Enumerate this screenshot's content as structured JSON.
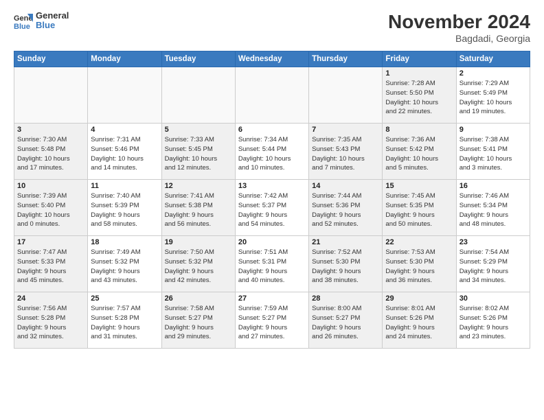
{
  "header": {
    "logo_line1": "General",
    "logo_line2": "Blue",
    "month": "November 2024",
    "location": "Bagdadi, Georgia"
  },
  "weekdays": [
    "Sunday",
    "Monday",
    "Tuesday",
    "Wednesday",
    "Thursday",
    "Friday",
    "Saturday"
  ],
  "weeks": [
    [
      {
        "day": "",
        "info": "",
        "empty": true
      },
      {
        "day": "",
        "info": "",
        "empty": true
      },
      {
        "day": "",
        "info": "",
        "empty": true
      },
      {
        "day": "",
        "info": "",
        "empty": true
      },
      {
        "day": "",
        "info": "",
        "empty": true
      },
      {
        "day": "1",
        "info": "Sunrise: 7:28 AM\nSunset: 5:50 PM\nDaylight: 10 hours\nand 22 minutes.",
        "shaded": true
      },
      {
        "day": "2",
        "info": "Sunrise: 7:29 AM\nSunset: 5:49 PM\nDaylight: 10 hours\nand 19 minutes."
      }
    ],
    [
      {
        "day": "3",
        "info": "Sunrise: 7:30 AM\nSunset: 5:48 PM\nDaylight: 10 hours\nand 17 minutes.",
        "shaded": true
      },
      {
        "day": "4",
        "info": "Sunrise: 7:31 AM\nSunset: 5:46 PM\nDaylight: 10 hours\nand 14 minutes."
      },
      {
        "day": "5",
        "info": "Sunrise: 7:33 AM\nSunset: 5:45 PM\nDaylight: 10 hours\nand 12 minutes.",
        "shaded": true
      },
      {
        "day": "6",
        "info": "Sunrise: 7:34 AM\nSunset: 5:44 PM\nDaylight: 10 hours\nand 10 minutes."
      },
      {
        "day": "7",
        "info": "Sunrise: 7:35 AM\nSunset: 5:43 PM\nDaylight: 10 hours\nand 7 minutes.",
        "shaded": true
      },
      {
        "day": "8",
        "info": "Sunrise: 7:36 AM\nSunset: 5:42 PM\nDaylight: 10 hours\nand 5 minutes.",
        "shaded": true
      },
      {
        "day": "9",
        "info": "Sunrise: 7:38 AM\nSunset: 5:41 PM\nDaylight: 10 hours\nand 3 minutes."
      }
    ],
    [
      {
        "day": "10",
        "info": "Sunrise: 7:39 AM\nSunset: 5:40 PM\nDaylight: 10 hours\nand 0 minutes.",
        "shaded": true
      },
      {
        "day": "11",
        "info": "Sunrise: 7:40 AM\nSunset: 5:39 PM\nDaylight: 9 hours\nand 58 minutes."
      },
      {
        "day": "12",
        "info": "Sunrise: 7:41 AM\nSunset: 5:38 PM\nDaylight: 9 hours\nand 56 minutes.",
        "shaded": true
      },
      {
        "day": "13",
        "info": "Sunrise: 7:42 AM\nSunset: 5:37 PM\nDaylight: 9 hours\nand 54 minutes."
      },
      {
        "day": "14",
        "info": "Sunrise: 7:44 AM\nSunset: 5:36 PM\nDaylight: 9 hours\nand 52 minutes.",
        "shaded": true
      },
      {
        "day": "15",
        "info": "Sunrise: 7:45 AM\nSunset: 5:35 PM\nDaylight: 9 hours\nand 50 minutes.",
        "shaded": true
      },
      {
        "day": "16",
        "info": "Sunrise: 7:46 AM\nSunset: 5:34 PM\nDaylight: 9 hours\nand 48 minutes."
      }
    ],
    [
      {
        "day": "17",
        "info": "Sunrise: 7:47 AM\nSunset: 5:33 PM\nDaylight: 9 hours\nand 45 minutes.",
        "shaded": true
      },
      {
        "day": "18",
        "info": "Sunrise: 7:49 AM\nSunset: 5:32 PM\nDaylight: 9 hours\nand 43 minutes."
      },
      {
        "day": "19",
        "info": "Sunrise: 7:50 AM\nSunset: 5:32 PM\nDaylight: 9 hours\nand 42 minutes.",
        "shaded": true
      },
      {
        "day": "20",
        "info": "Sunrise: 7:51 AM\nSunset: 5:31 PM\nDaylight: 9 hours\nand 40 minutes."
      },
      {
        "day": "21",
        "info": "Sunrise: 7:52 AM\nSunset: 5:30 PM\nDaylight: 9 hours\nand 38 minutes.",
        "shaded": true
      },
      {
        "day": "22",
        "info": "Sunrise: 7:53 AM\nSunset: 5:30 PM\nDaylight: 9 hours\nand 36 minutes.",
        "shaded": true
      },
      {
        "day": "23",
        "info": "Sunrise: 7:54 AM\nSunset: 5:29 PM\nDaylight: 9 hours\nand 34 minutes."
      }
    ],
    [
      {
        "day": "24",
        "info": "Sunrise: 7:56 AM\nSunset: 5:28 PM\nDaylight: 9 hours\nand 32 minutes.",
        "shaded": true
      },
      {
        "day": "25",
        "info": "Sunrise: 7:57 AM\nSunset: 5:28 PM\nDaylight: 9 hours\nand 31 minutes."
      },
      {
        "day": "26",
        "info": "Sunrise: 7:58 AM\nSunset: 5:27 PM\nDaylight: 9 hours\nand 29 minutes.",
        "shaded": true
      },
      {
        "day": "27",
        "info": "Sunrise: 7:59 AM\nSunset: 5:27 PM\nDaylight: 9 hours\nand 27 minutes."
      },
      {
        "day": "28",
        "info": "Sunrise: 8:00 AM\nSunset: 5:27 PM\nDaylight: 9 hours\nand 26 minutes.",
        "shaded": true
      },
      {
        "day": "29",
        "info": "Sunrise: 8:01 AM\nSunset: 5:26 PM\nDaylight: 9 hours\nand 24 minutes.",
        "shaded": true
      },
      {
        "day": "30",
        "info": "Sunrise: 8:02 AM\nSunset: 5:26 PM\nDaylight: 9 hours\nand 23 minutes."
      }
    ]
  ]
}
